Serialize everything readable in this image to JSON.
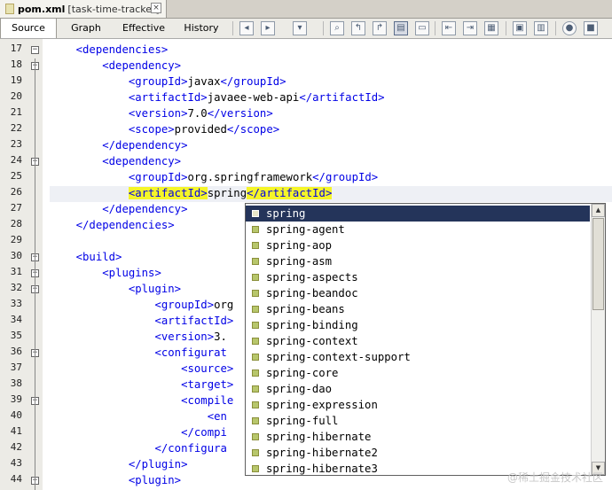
{
  "editor_tab": {
    "file": "pom.xml",
    "project": "[task-time-tracker]",
    "close": "×"
  },
  "view_tabs": [
    "Source",
    "Graph",
    "Effective",
    "History"
  ],
  "toolbar_icons": [
    "back-icon",
    "forward-icon",
    "history-icon",
    "find-icon",
    "find-prev-icon",
    "find-next-icon",
    "toggle-highlight-icon",
    "toggle-rect-select-icon",
    "shift-left-icon",
    "shift-right-icon",
    "comment-icon",
    "start-macro-icon",
    "stop-macro-icon",
    "run-icon",
    "stop-icon"
  ],
  "gutter": {
    "line_numbers": [
      "17",
      "18",
      "19",
      "20",
      "21",
      "22",
      "23",
      "24",
      "25",
      "26",
      "27",
      "28",
      "29",
      "30",
      "31",
      "32",
      "33",
      "34",
      "35",
      "36",
      "37",
      "38",
      "39",
      "40",
      "41",
      "42",
      "43",
      "44"
    ],
    "fold_markers": [
      "−",
      "−",
      "",
      "",
      "",
      "",
      "",
      "−",
      "",
      "",
      "",
      "",
      "",
      "−",
      "−",
      "−",
      "",
      "",
      "",
      "−",
      "",
      "",
      "−",
      "",
      "",
      "",
      "",
      "−"
    ]
  },
  "code_lines": [
    {
      "indent": "    ",
      "parts": [
        {
          "t": "<dependencies>",
          "tag": true
        }
      ]
    },
    {
      "indent": "        ",
      "parts": [
        {
          "t": "<dependency>",
          "tag": true
        }
      ]
    },
    {
      "indent": "            ",
      "parts": [
        {
          "t": "<groupId>",
          "tag": true
        },
        {
          "t": "javax",
          "tag": false
        },
        {
          "t": "</groupId>",
          "tag": true
        }
      ]
    },
    {
      "indent": "            ",
      "parts": [
        {
          "t": "<artifactId>",
          "tag": true
        },
        {
          "t": "javaee-web-api",
          "tag": false
        },
        {
          "t": "</artifactId>",
          "tag": true
        }
      ]
    },
    {
      "indent": "            ",
      "parts": [
        {
          "t": "<version>",
          "tag": true
        },
        {
          "t": "7.0",
          "tag": false
        },
        {
          "t": "</version>",
          "tag": true
        }
      ]
    },
    {
      "indent": "            ",
      "parts": [
        {
          "t": "<scope>",
          "tag": true
        },
        {
          "t": "provided",
          "tag": false
        },
        {
          "t": "</scope>",
          "tag": true
        }
      ]
    },
    {
      "indent": "        ",
      "parts": [
        {
          "t": "</dependency>",
          "tag": true
        }
      ]
    },
    {
      "indent": "        ",
      "parts": [
        {
          "t": "<dependency>",
          "tag": true
        }
      ]
    },
    {
      "indent": "            ",
      "parts": [
        {
          "t": "<groupId>",
          "tag": true
        },
        {
          "t": "org.springframework",
          "tag": false
        },
        {
          "t": "</groupId>",
          "tag": true
        }
      ]
    },
    {
      "indent": "            ",
      "parts": [
        {
          "t": "<artifactId>",
          "tag": true,
          "hl": true
        },
        {
          "t": "spring",
          "tag": false
        },
        {
          "t": "</artifactId>",
          "tag": true,
          "hl": true
        }
      ]
    },
    {
      "indent": "        ",
      "parts": [
        {
          "t": "</dependency>",
          "tag": true
        }
      ]
    },
    {
      "indent": "    ",
      "parts": [
        {
          "t": "</dependencies>",
          "tag": true
        }
      ]
    },
    {
      "indent": "",
      "parts": []
    },
    {
      "indent": "    ",
      "parts": [
        {
          "t": "<build>",
          "tag": true
        }
      ]
    },
    {
      "indent": "        ",
      "parts": [
        {
          "t": "<plugins>",
          "tag": true
        }
      ]
    },
    {
      "indent": "            ",
      "parts": [
        {
          "t": "<plugin>",
          "tag": true
        }
      ]
    },
    {
      "indent": "                ",
      "parts": [
        {
          "t": "<groupId>",
          "tag": true
        },
        {
          "t": "org",
          "tag": false
        }
      ]
    },
    {
      "indent": "                ",
      "parts": [
        {
          "t": "<artifactId>",
          "tag": true
        }
      ]
    },
    {
      "indent": "                ",
      "parts": [
        {
          "t": "<version>",
          "tag": true
        },
        {
          "t": "3.",
          "tag": false
        }
      ]
    },
    {
      "indent": "                ",
      "parts": [
        {
          "t": "<configurat",
          "tag": true
        }
      ]
    },
    {
      "indent": "                    ",
      "parts": [
        {
          "t": "<source>",
          "tag": true
        }
      ]
    },
    {
      "indent": "                    ",
      "parts": [
        {
          "t": "<target>",
          "tag": true
        }
      ]
    },
    {
      "indent": "                    ",
      "parts": [
        {
          "t": "<compile",
          "tag": true
        }
      ]
    },
    {
      "indent": "                        ",
      "parts": [
        {
          "t": "<en",
          "tag": true
        }
      ]
    },
    {
      "indent": "                    ",
      "parts": [
        {
          "t": "</compi",
          "tag": true
        }
      ]
    },
    {
      "indent": "                ",
      "parts": [
        {
          "t": "</configura",
          "tag": true
        }
      ]
    },
    {
      "indent": "            ",
      "parts": [
        {
          "t": "</plugin>",
          "tag": true
        }
      ]
    },
    {
      "indent": "            ",
      "parts": [
        {
          "t": "<plugin>",
          "tag": true
        }
      ]
    }
  ],
  "completion": {
    "selected_index": 0,
    "items": [
      "spring",
      "spring-agent",
      "spring-aop",
      "spring-asm",
      "spring-aspects",
      "spring-beandoc",
      "spring-beans",
      "spring-binding",
      "spring-context",
      "spring-context-support",
      "spring-core",
      "spring-dao",
      "spring-expression",
      "spring-full",
      "spring-hibernate",
      "spring-hibernate2",
      "spring-hibernate3"
    ]
  },
  "watermark": "@稀土掘金技术社区",
  "colors": {
    "tag": "#0000e6",
    "highlight": "#f5f528",
    "selection": "#24345a"
  }
}
